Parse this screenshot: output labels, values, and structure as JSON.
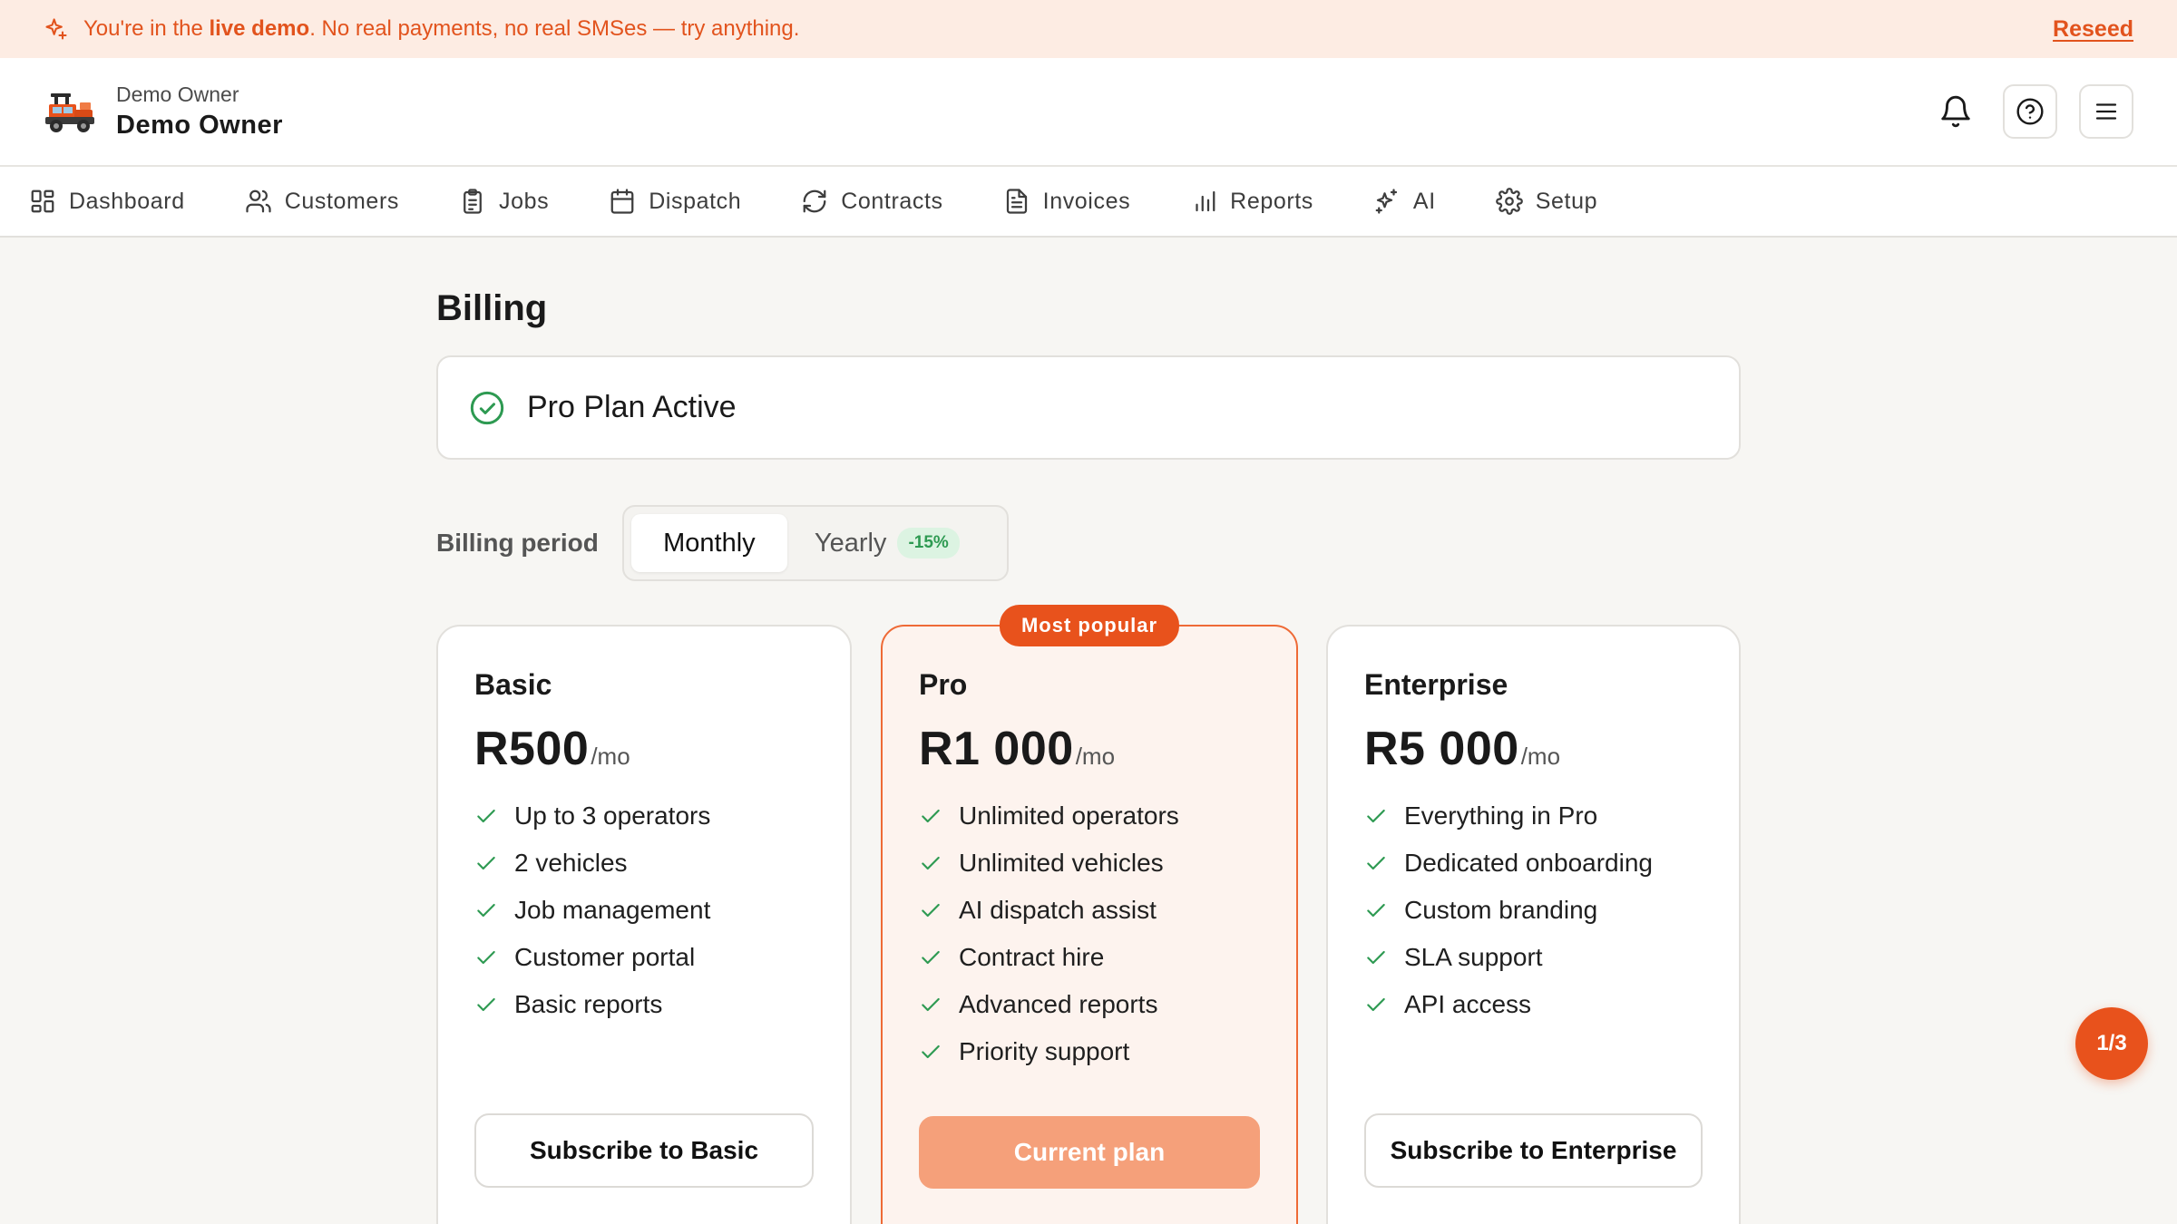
{
  "banner": {
    "prefix": "You're in the ",
    "bold": "live demo",
    "suffix": ". No real payments, no real SMSes — try anything.",
    "reseed": "Reseed"
  },
  "header": {
    "org_subtitle": "Demo Owner",
    "org_name": "Demo Owner"
  },
  "nav": {
    "items": [
      {
        "label": "Dashboard",
        "icon": "grid-icon"
      },
      {
        "label": "Customers",
        "icon": "users-icon"
      },
      {
        "label": "Jobs",
        "icon": "clipboard-icon"
      },
      {
        "label": "Dispatch",
        "icon": "calendar-icon"
      },
      {
        "label": "Contracts",
        "icon": "refresh-icon"
      },
      {
        "label": "Invoices",
        "icon": "file-icon"
      },
      {
        "label": "Reports",
        "icon": "bar-chart-icon"
      },
      {
        "label": "AI",
        "icon": "sparkles-icon"
      },
      {
        "label": "Setup",
        "icon": "gear-icon"
      }
    ]
  },
  "page": {
    "title": "Billing",
    "status": "Pro Plan Active",
    "period_label": "Billing period",
    "monthly": "Monthly",
    "yearly": "Yearly",
    "yearly_discount": "-15%"
  },
  "plans": {
    "basic": {
      "name": "Basic",
      "price": "R500",
      "per": "/mo",
      "features": [
        "Up to 3 operators",
        "2 vehicles",
        "Job management",
        "Customer portal",
        "Basic reports"
      ],
      "button": "Subscribe to Basic"
    },
    "pro": {
      "badge": "Most popular",
      "name": "Pro",
      "price": "R1 000",
      "per": "/mo",
      "features": [
        "Unlimited operators",
        "Unlimited vehicles",
        "AI dispatch assist",
        "Contract hire",
        "Advanced reports",
        "Priority support"
      ],
      "button": "Current plan"
    },
    "enterprise": {
      "name": "Enterprise",
      "price": "R5 000",
      "per": "/mo",
      "features": [
        "Everything in Pro",
        "Dedicated onboarding",
        "Custom branding",
        "SLA support",
        "API access"
      ],
      "button": "Subscribe to Enterprise"
    }
  },
  "pager": "1/3",
  "colors": {
    "accent": "#e8521c",
    "banner_bg": "#fdece3",
    "success": "#2e9a52",
    "page_bg": "#f7f6f3"
  }
}
